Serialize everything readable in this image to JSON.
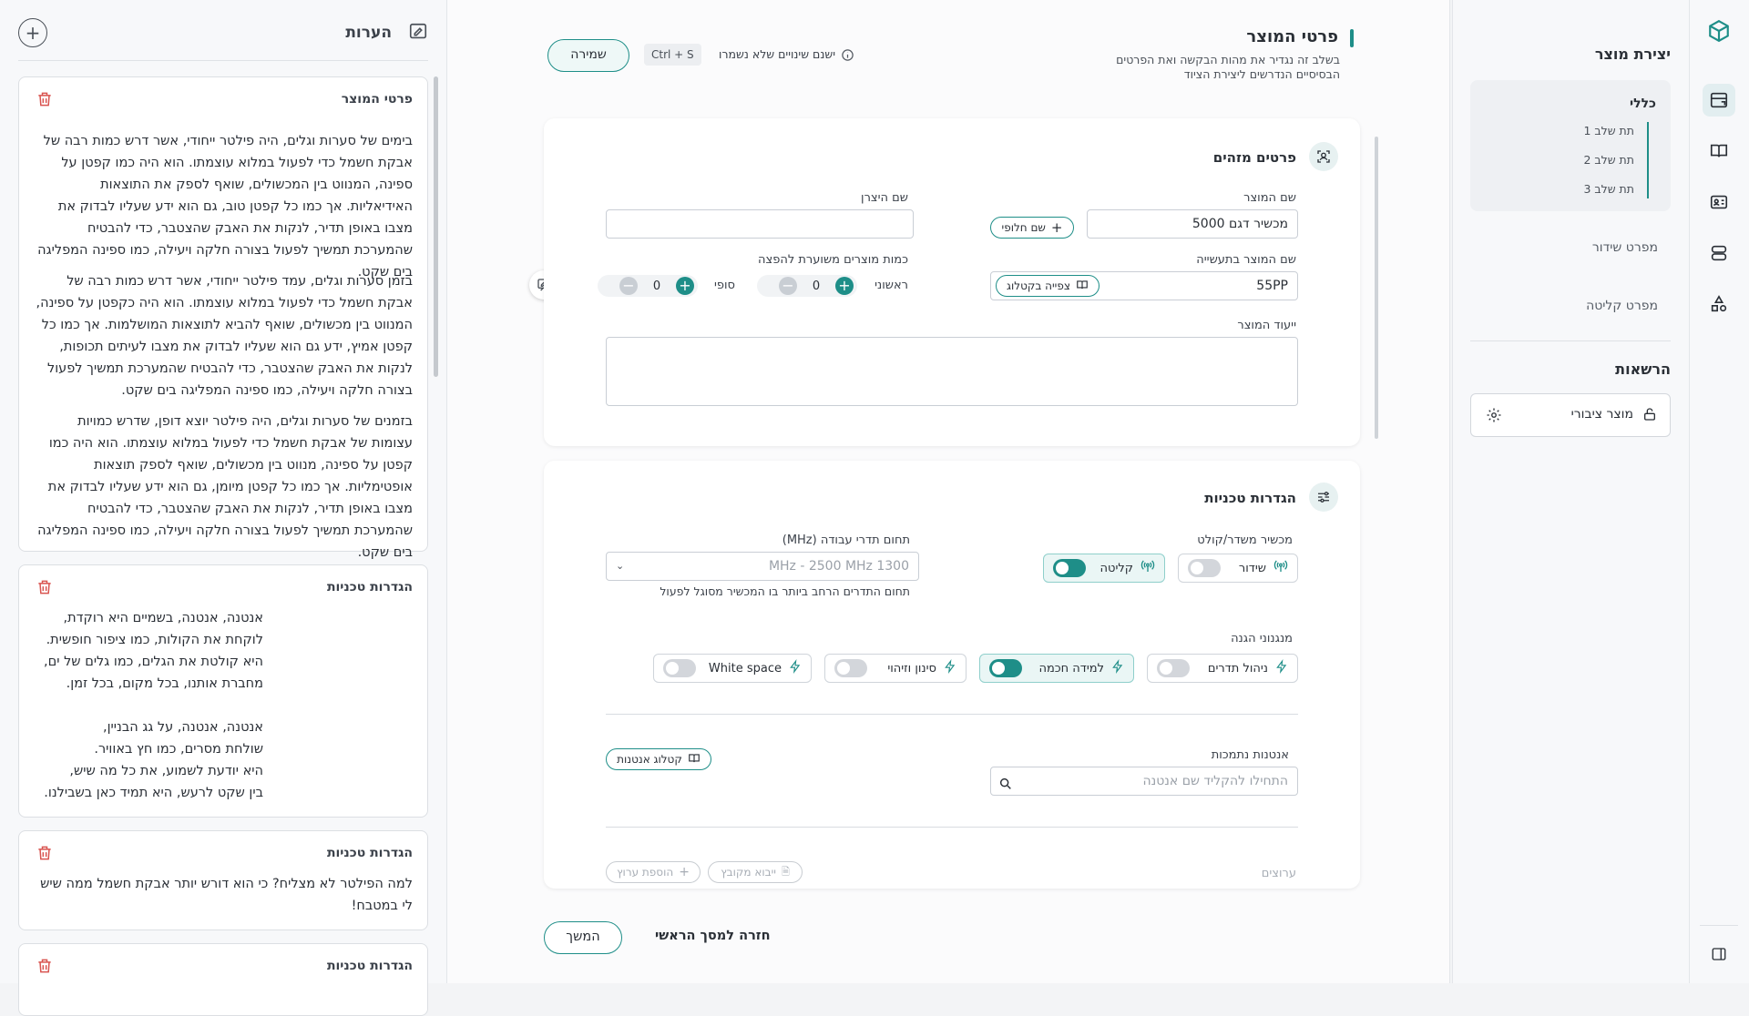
{
  "notes_panel": {
    "title": "הערות",
    "notes": [
      {
        "heading": "פרטי המוצר",
        "paragraphs": [
          "בימים של סערות וגלים, היה פילטר ייחודי, אשר דרש כמות רבה של אבקת חשמל כדי לפעול במלוא עוצמתו. הוא היה כמו קפטן על ספינה, המנווט בין המכשולים, שואף לספק את התוצאות האידיאליות. אך כמו כל קפטן טוב, גם הוא ידע שעליו לבדוק את מצבו באופן תדיר, לנקות את האבק שהצטבר, כדי להבטיח שהמערכת תמשיך לפעול בצורה חלקה ויעילה, כמו ספינה המפליגה בים שקט.",
          "בזמן סערות וגלים, עמד פילטר ייחודי, אשר דרש כמות רבה של אבקת חשמל כדי לפעול במלוא עוצמתו. הוא היה כקפטן על ספינה, המנווט בין מכשולים, שואף להביא לתוצאות המושלמות. אך כמו כל קפטן אמיץ, ידע גם הוא שעליו לבדוק את מצבו לעיתים תכופות, לנקות את האבק שהצטבר, כדי להבטיח שהמערכת תמשיך לפעול בצורה חלקה ויעילה, כמו ספינה המפליגה בים שקט.",
          "בזמנים של סערות וגלים, היה פילטר יוצא דופן, שדרש כמויות עצומות של אבקת חשמל כדי לפעול במלוא עוצמתו. הוא היה כמו קפטן על ספינה, מנווט בין מכשולים, שואף לספק תוצאות אופטימליות. אך כמו כל קפטן מיומן, גם הוא ידע שעליו לבדוק את מצבו באופן תדיר, לנקות את האבק שהצטבר, כדי להבטיח שהמערכת תמשיך לפעול בצורה חלקה ויעילה, כמו ספינה המפליגה בים שקט."
        ]
      },
      {
        "heading": "הגדרות טכניות",
        "text": "אנטנה, אנטנה, בשמיים היא רוקדת,\nלוקחת את הקולות, כמו ציפור חופשית.\nהיא קולטת את הגלים, כמו גלים של ים,\nמחברת אותנו, בכל מקום, בכל זמן.\n\nאנטנה, אנטנה, על גג הבניין,\nשולחת מסרים, כמו חץ באוויר.\nהיא יודעת לשמוע, את כל מה שיש,\nבין שקט לרעש, היא תמיד כאן בשבילנו."
      },
      {
        "heading": "הגדרות טכניות",
        "text": "למה הפילטר לא מצליח? כי הוא דורש יותר אבקת חשמל ממה שיש לי במטבח!"
      },
      {
        "heading": "הגדרות טכניות"
      }
    ]
  },
  "header": {
    "title": "פרטי המוצר",
    "subtitle_line1": "בשלב זה נגדיר את מהות הבקשה ואת הפרטים",
    "subtitle_line2": "הבסיסיים הנדרשים ליצירת הציוד",
    "unsaved_text": "ישנם שינויים שלא נשמרו",
    "shortcut": "Ctrl + S",
    "save_label": "שמירה"
  },
  "identifying": {
    "title": "פרטים מזהים",
    "product_name_label": "שם המוצר",
    "product_name_value": "מכשיר דגם 5000",
    "alt_name_button": "שם חלופי",
    "manufacturer_label": "שם היצרן",
    "manufacturer_value": "",
    "industry_name_label": "שם המוצר בתעשייה",
    "industry_name_value": "55PP",
    "catalog_view_button": "צפייה בקטלוג",
    "quantity_label": "כמות מוצרים משוערת להפצה",
    "initial_label": "ראשוני",
    "initial_value": "0",
    "final_label": "סופי",
    "final_value": "0",
    "purpose_label": "ייעוד המוצר",
    "purpose_value": ""
  },
  "technical": {
    "title": "הגדרות טכניות",
    "device_type_label": "מכשיר משדר/קולט",
    "transmit_label": "שידור",
    "transmit_on": false,
    "receive_label": "קליטה",
    "receive_on": true,
    "freq_label": "תחום תדרי עבודה (MHz)",
    "freq_placeholder": "1300 MHz - 2500 MHz",
    "freq_help": "תחום התדרים הרחב ביותר בו המכשיר מסוגל לפעול",
    "protection_label": "מנגנוני הגנה",
    "mechanisms": [
      {
        "label": "ניהול תדרים",
        "on": false
      },
      {
        "label": "למידה חכמה",
        "on": true
      },
      {
        "label": "סינון וזיהוי",
        "on": false
      },
      {
        "label": "White space",
        "on": false
      }
    ],
    "antennas_label": "אנטנות נתמכות",
    "antennas_placeholder": "התחילו להקליד שם אנטנה",
    "antenna_catalog_button": "קטלוג אנטנות",
    "channels_label": "ערוצים",
    "import_file_button": "ייבוא מקובץ",
    "add_channel_button": "הוספת ערוץ"
  },
  "footer": {
    "back_label": "חזרה למסך הראשי",
    "continue_label": "המשך"
  },
  "nav": {
    "title": "יצירת מוצר",
    "general_label": "כללי",
    "substeps": [
      "תת שלב 1",
      "תת שלב 2",
      "תת שלב 3"
    ],
    "broadcast_spec": "מפרט שידור",
    "receive_spec": "מפרט קליטה",
    "permissions_title": "הרשאות",
    "public_product": "מוצר ציבורי"
  },
  "colors": {
    "accent": "#1e8e88",
    "danger": "#d9534f"
  }
}
